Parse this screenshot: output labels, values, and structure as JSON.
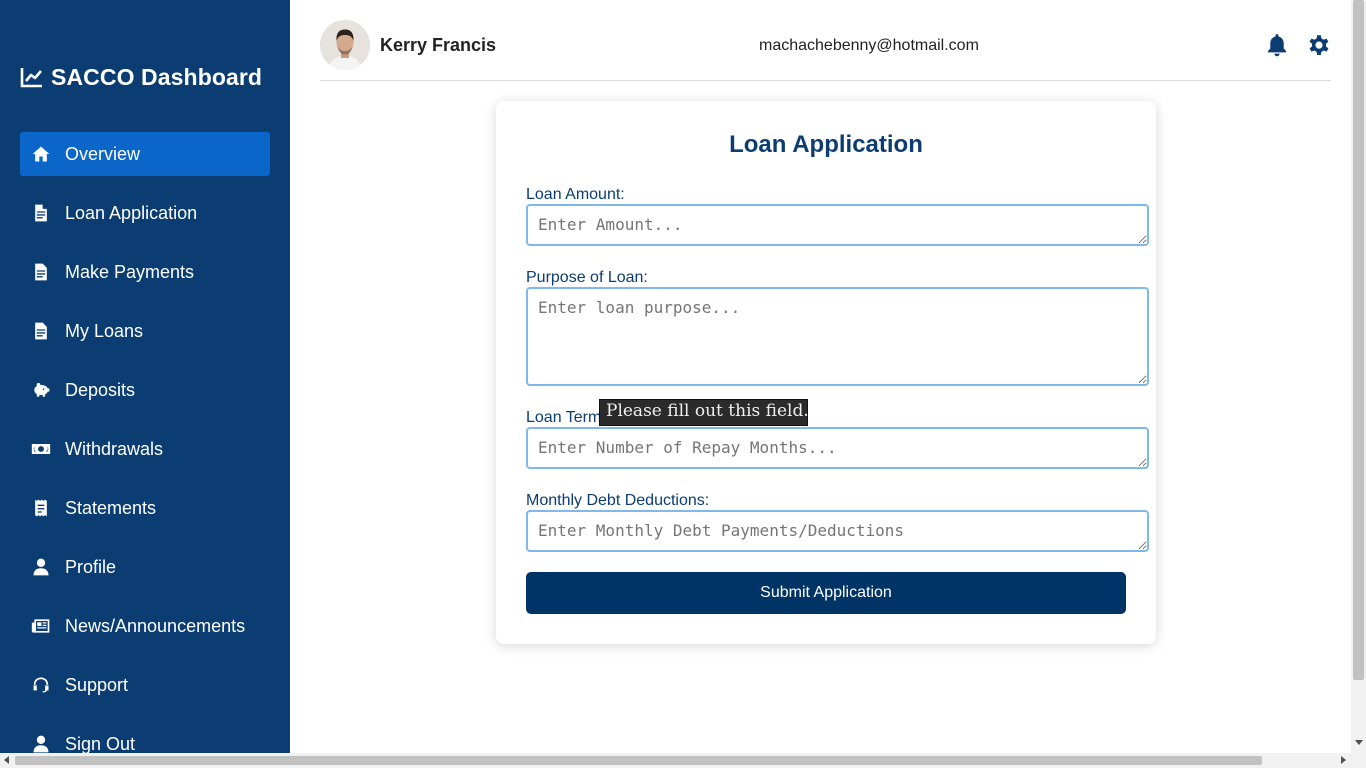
{
  "sidebar": {
    "brand_title": "SACCO Dashboard",
    "brand_icon": "line-chart-icon",
    "items": [
      {
        "label": "Overview",
        "icon": "home-icon",
        "active": true
      },
      {
        "label": "Loan Application",
        "icon": "document-icon"
      },
      {
        "label": "Make Payments",
        "icon": "document-icon"
      },
      {
        "label": "My Loans",
        "icon": "document-icon"
      },
      {
        "label": "Deposits",
        "icon": "piggy-bank-icon"
      },
      {
        "label": "Withdrawals",
        "icon": "money-bill-icon"
      },
      {
        "label": "Statements",
        "icon": "receipt-icon"
      },
      {
        "label": "Profile",
        "icon": "user-icon"
      },
      {
        "label": "News/Announcements",
        "icon": "newspaper-icon"
      },
      {
        "label": "Support",
        "icon": "headset-icon"
      },
      {
        "label": "Sign Out",
        "icon": "user-icon"
      }
    ]
  },
  "header": {
    "user_name": "Kerry Francis",
    "user_email": "machachebenny@hotmail.com",
    "icons": [
      "bell-icon",
      "gear-icon"
    ]
  },
  "loan_form": {
    "title": "Loan Application",
    "amount_label": "Loan Amount:",
    "amount_placeholder": "Enter Amount...",
    "purpose_label": "Purpose of Loan:",
    "purpose_placeholder": "Enter loan purpose...",
    "term_label": "Loan Term",
    "term_placeholder": "Enter Number of Repay Months...",
    "deductions_label": "Monthly Debt Deductions:",
    "deductions_placeholder": "Enter Monthly Debt Payments/Deductions",
    "submit_label": "Submit Application"
  },
  "validation_tooltip": "Please fill out this field.",
  "colors": {
    "sidebar_bg": "#0b3d73",
    "active_item": "#0b66c9",
    "primary": "#003366",
    "input_border": "#7fb8ea"
  }
}
